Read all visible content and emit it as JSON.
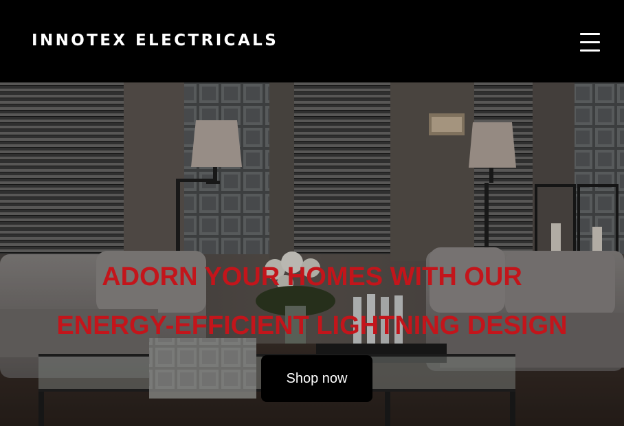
{
  "header": {
    "brand": "INNOTEX ELECTRICALS",
    "menu_icon": "hamburger-menu-icon"
  },
  "hero": {
    "headline_line1": "ADORN YOUR HOMES WITH OUR",
    "headline_line2": "ENERGY-EFFICIENT LIGHTNING DESIGN",
    "cta_label": "Shop now",
    "background_image": "living-room-photo"
  },
  "colors": {
    "header_bg": "#000000",
    "headline": "#c3151b",
    "cta_bg": "#000000",
    "cta_text": "#ffffff"
  }
}
